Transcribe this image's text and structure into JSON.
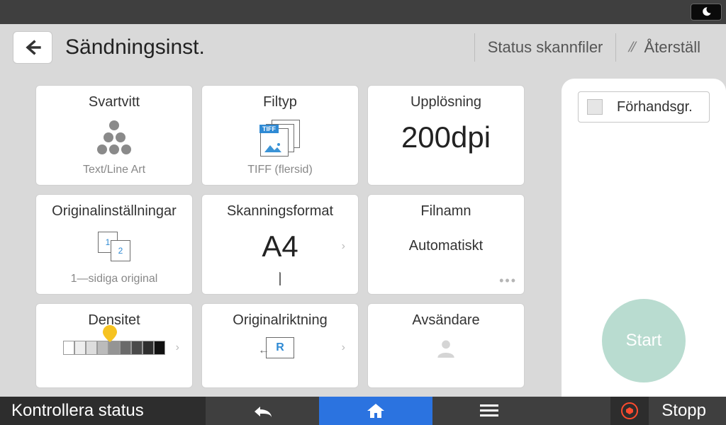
{
  "topbar": {
    "night_icon": "moon-icon"
  },
  "header": {
    "title": "Sändningsinst.",
    "status_link": "Status skannfiler",
    "reset_label": "Återställ"
  },
  "tiles": {
    "color": {
      "title": "Svartvitt",
      "sub": "Text/Line Art"
    },
    "filetype": {
      "title": "Filtyp",
      "sub": "TIFF (flersid)",
      "badge": "TIFF"
    },
    "resolution": {
      "title": "Upplösning",
      "value": "200dpi"
    },
    "original": {
      "title": "Originalinställningar",
      "sub": "1—sidiga original"
    },
    "scansize": {
      "title": "Skanningsformat",
      "value": "A4"
    },
    "filename": {
      "title": "Filnamn",
      "value": "Automatiskt"
    },
    "density": {
      "title": "Densitet"
    },
    "orientation": {
      "title": "Originalriktning"
    },
    "sender": {
      "title": "Avsändare"
    }
  },
  "right": {
    "preview_label": "Förhandsgr.",
    "start_label": "Start"
  },
  "bottom": {
    "status": "Kontrollera status",
    "stop": "Stopp"
  },
  "colors": {
    "accent": "#2b73e0",
    "start": "#b9dcd0",
    "stop": "#ff4b2e",
    "marker": "#f6c321"
  }
}
